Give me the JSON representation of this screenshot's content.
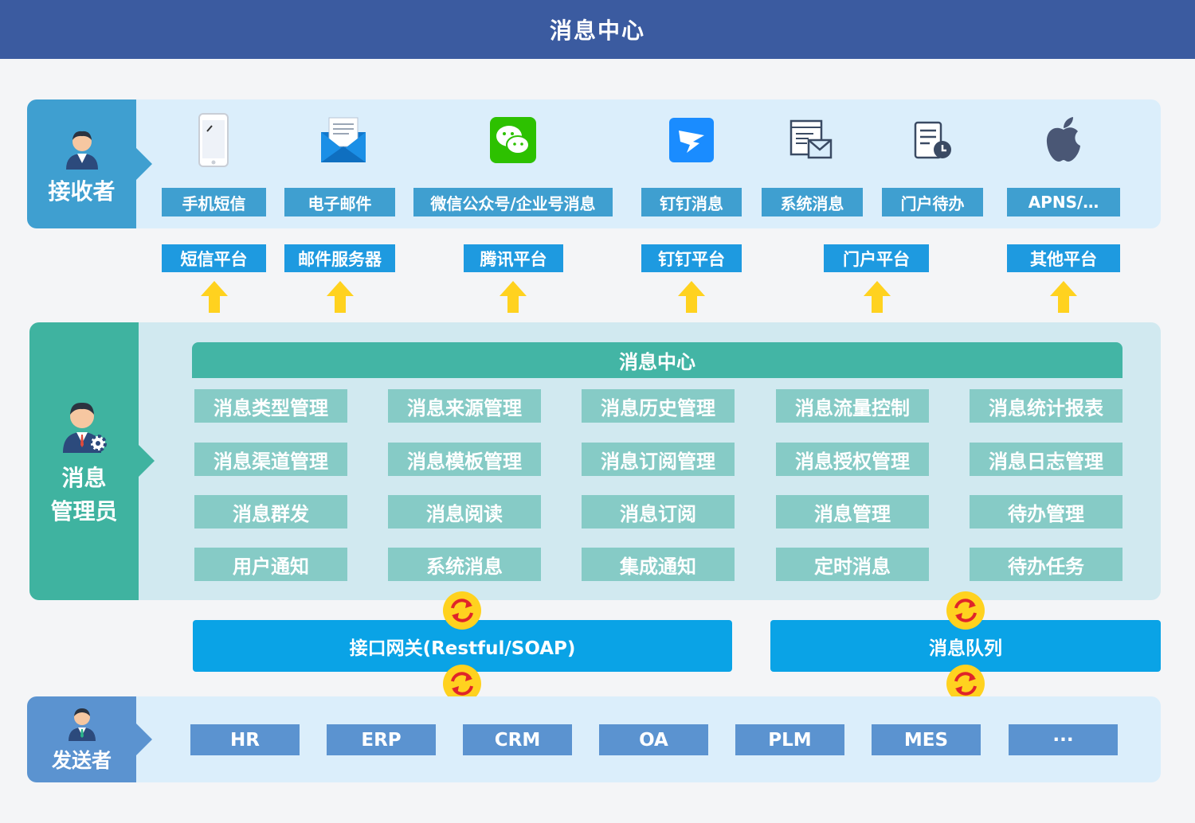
{
  "title": "消息中心",
  "receiver": {
    "label": "接收者",
    "channels": [
      {
        "label": "手机短信",
        "icon": "mobile-phone-icon"
      },
      {
        "label": "电子邮件",
        "icon": "email-envelope-icon"
      },
      {
        "label": "微信公众号/企业号消息",
        "icon": "wechat-icon"
      },
      {
        "label": "钉钉消息",
        "icon": "dingtalk-icon"
      },
      {
        "label": "系统消息",
        "icon": "system-message-icon"
      },
      {
        "label": "门户待办",
        "icon": "portal-todo-icon"
      },
      {
        "label": "APNS/…",
        "icon": "apple-icon"
      }
    ]
  },
  "platforms": [
    "短信平台",
    "邮件服务器",
    "腾讯平台",
    "钉钉平台",
    "门户平台",
    "其他平台"
  ],
  "admin": {
    "label_line1": "消息",
    "label_line2": "管理员",
    "hub_title": "消息中心",
    "functions": [
      [
        "消息类型管理",
        "消息来源管理",
        "消息历史管理",
        "消息流量控制",
        "消息统计报表"
      ],
      [
        "消息渠道管理",
        "消息模板管理",
        "消息订阅管理",
        "消息授权管理",
        "消息日志管理"
      ],
      [
        "消息群发",
        "消息阅读",
        "消息订阅",
        "消息管理",
        "待办管理"
      ],
      [
        "用户通知",
        "系统消息",
        "集成通知",
        "定时消息",
        "待办任务"
      ]
    ]
  },
  "middleware": {
    "gateway": "接口网关(Restful/SOAP)",
    "queue": "消息队列"
  },
  "sender": {
    "label": "发送者",
    "systems": [
      "HR",
      "ERP",
      "CRM",
      "OA",
      "PLM",
      "MES",
      "···"
    ]
  },
  "colors": {
    "title_bg": "#3b5ba0",
    "receiver": "#3f9fd0",
    "platform": "#1e9ae0",
    "admin": "#3fb3a0",
    "function": "#86cbc6",
    "middleware": "#0aa3e6",
    "sender": "#5b93d0",
    "arrow": "#ffd21f"
  }
}
